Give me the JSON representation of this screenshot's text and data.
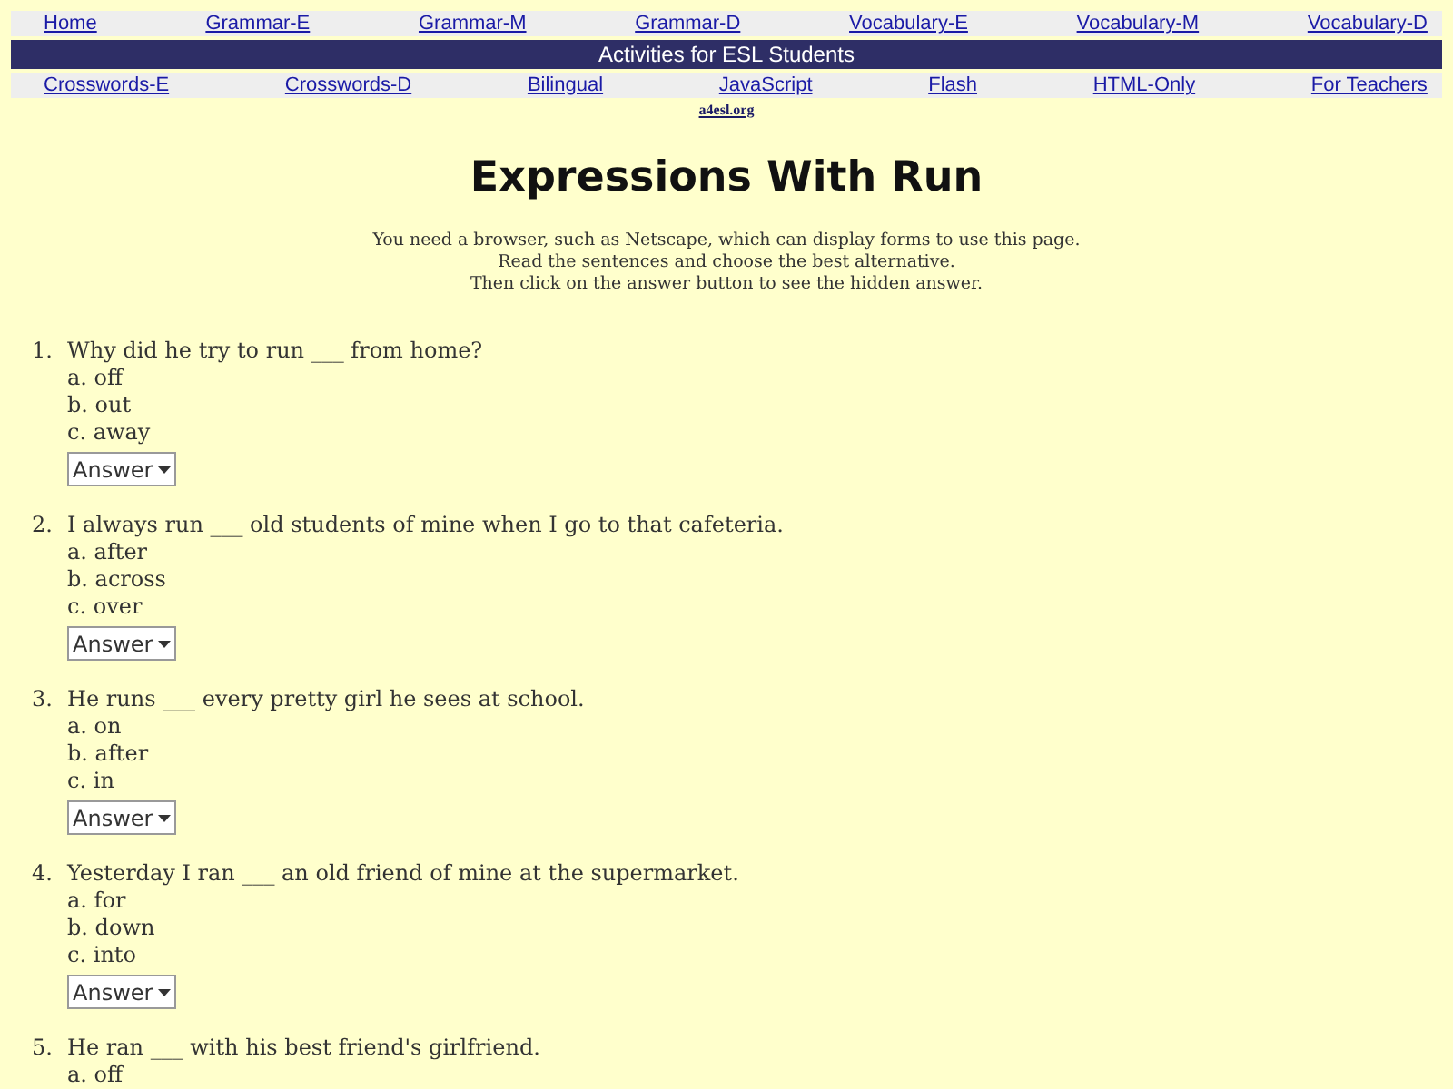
{
  "nav_top": [
    "Home",
    "Grammar-E",
    "Grammar-M",
    "Grammar-D",
    "Vocabulary-E",
    "Vocabulary-M",
    "Vocabulary-D"
  ],
  "banner": "Activities for ESL Students",
  "nav_bottom": [
    "Crosswords-E",
    "Crosswords-D",
    "Bilingual",
    "JavaScript",
    "Flash",
    "HTML-Only",
    "For Teachers"
  ],
  "site_link": "a4esl.org",
  "title": "Expressions With Run",
  "instructions": [
    "You need a browser, such as Netscape, which can display forms to use this page.",
    "Read the sentences and choose the best alternative.",
    "Then click on the answer button to see the hidden answer."
  ],
  "questions": [
    {
      "number": "1.",
      "text": "Why did he try to run ___ from home?",
      "options": [
        "a. off",
        "b. out",
        "c. away"
      ],
      "answer_button": "Answer"
    },
    {
      "number": "2.",
      "text": "I always run ___ old students of mine when I go to that cafeteria.",
      "options": [
        "a. after",
        "b. across",
        "c. over"
      ],
      "answer_button": "Answer"
    },
    {
      "number": "3.",
      "text": "He runs ___ every pretty girl he sees at school.",
      "options": [
        "a. on",
        "b. after",
        "c. in"
      ],
      "answer_button": "Answer"
    },
    {
      "number": "4.",
      "text": "Yesterday I ran ___ an old friend of mine at the supermarket.",
      "options": [
        "a. for",
        "b. down",
        "c. into"
      ],
      "answer_button": "Answer"
    },
    {
      "number": "5.",
      "text": "He ran ___ with his best friend's girlfriend.",
      "options": [
        "a. off"
      ]
    }
  ]
}
